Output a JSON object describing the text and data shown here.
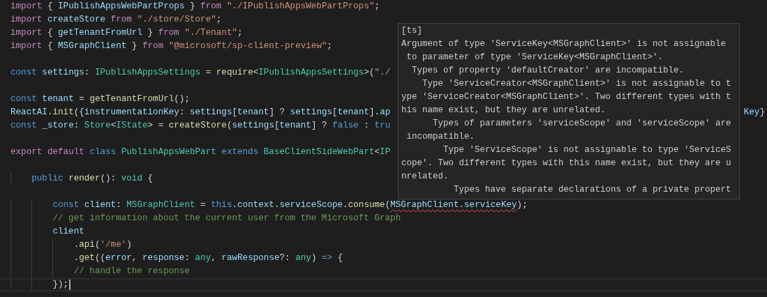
{
  "editor": {
    "lines": [
      {
        "current": false,
        "tokens": [
          {
            "text": "import ",
            "kind": "keyword"
          },
          {
            "text": "{ ",
            "kind": "plain"
          },
          {
            "text": "IPublishAppsWebPartProps ",
            "kind": "variable"
          },
          {
            "text": "} ",
            "kind": "plain"
          },
          {
            "text": "from ",
            "kind": "keyword"
          },
          {
            "text": "\"./IPublishAppsWebPartProps\"",
            "kind": "string"
          },
          {
            "text": ";",
            "kind": "plain"
          }
        ]
      },
      {
        "current": false,
        "tokens": [
          {
            "text": "import ",
            "kind": "keyword"
          },
          {
            "text": "createStore ",
            "kind": "variable"
          },
          {
            "text": "from ",
            "kind": "keyword"
          },
          {
            "text": "\"./store/Store\"",
            "kind": "string"
          },
          {
            "text": ";",
            "kind": "plain"
          }
        ]
      },
      {
        "current": false,
        "tokens": [
          {
            "text": "import ",
            "kind": "keyword"
          },
          {
            "text": "{ ",
            "kind": "plain"
          },
          {
            "text": "getTenantFromUrl ",
            "kind": "variable"
          },
          {
            "text": "} ",
            "kind": "plain"
          },
          {
            "text": "from ",
            "kind": "keyword"
          },
          {
            "text": "\"./Tenant\"",
            "kind": "string"
          },
          {
            "text": ";",
            "kind": "plain"
          }
        ]
      },
      {
        "current": false,
        "tokens": [
          {
            "text": "import ",
            "kind": "keyword"
          },
          {
            "text": "{ ",
            "kind": "plain"
          },
          {
            "text": "MSGraphClient ",
            "kind": "variable"
          },
          {
            "text": "} ",
            "kind": "plain"
          },
          {
            "text": "from ",
            "kind": "keyword"
          },
          {
            "text": "\"@microsoft/sp-client-preview\"",
            "kind": "string"
          },
          {
            "text": ";",
            "kind": "plain"
          }
        ]
      },
      {
        "current": false
      },
      {
        "current": false,
        "tokens": [
          {
            "text": "const ",
            "kind": "storage"
          },
          {
            "text": "settings",
            "kind": "variable"
          },
          {
            "text": ": ",
            "kind": "plain"
          },
          {
            "text": "IPublishAppsSettings ",
            "kind": "type"
          },
          {
            "text": "= ",
            "kind": "plain"
          },
          {
            "text": "require",
            "kind": "function"
          },
          {
            "text": "<",
            "kind": "plain"
          },
          {
            "text": "IPublishAppsSettings",
            "kind": "type"
          },
          {
            "text": ">(",
            "kind": "plain"
          },
          {
            "text": "\"./",
            "kind": "string"
          }
        ]
      },
      {
        "current": false
      },
      {
        "current": false,
        "tokens": [
          {
            "text": "const ",
            "kind": "storage"
          },
          {
            "text": "tenant ",
            "kind": "variable"
          },
          {
            "text": "= ",
            "kind": "plain"
          },
          {
            "text": "getTenantFromUrl",
            "kind": "function"
          },
          {
            "text": "();",
            "kind": "plain"
          }
        ]
      },
      {
        "current": false,
        "tokens": [
          {
            "text": "ReactAI",
            "kind": "variable"
          },
          {
            "text": ".",
            "kind": "plain"
          },
          {
            "text": "init",
            "kind": "function"
          },
          {
            "text": "({",
            "kind": "plain"
          },
          {
            "text": "instrumentationKey",
            "kind": "variable"
          },
          {
            "text": ": ",
            "kind": "plain"
          },
          {
            "text": "settings",
            "kind": "variable"
          },
          {
            "text": "[",
            "kind": "plain"
          },
          {
            "text": "tenant",
            "kind": "variable"
          },
          {
            "text": "] ? ",
            "kind": "plain"
          },
          {
            "text": "settings",
            "kind": "variable"
          },
          {
            "text": "[",
            "kind": "plain"
          },
          {
            "text": "tenant",
            "kind": "variable"
          },
          {
            "text": "].",
            "kind": "plain"
          },
          {
            "text": "ap",
            "kind": "variable"
          }
        ],
        "tail": [
          {
            "text": "Key",
            "kind": "variable"
          },
          {
            "text": "}",
            "kind": "plain"
          }
        ]
      },
      {
        "current": false,
        "tokens": [
          {
            "text": "const ",
            "kind": "storage"
          },
          {
            "text": "_store",
            "kind": "variable"
          },
          {
            "text": ": ",
            "kind": "plain"
          },
          {
            "text": "Store",
            "kind": "type"
          },
          {
            "text": "<",
            "kind": "plain"
          },
          {
            "text": "IState",
            "kind": "type"
          },
          {
            "text": "> = ",
            "kind": "plain"
          },
          {
            "text": "createStore",
            "kind": "function"
          },
          {
            "text": "(",
            "kind": "plain"
          },
          {
            "text": "settings",
            "kind": "variable"
          },
          {
            "text": "[",
            "kind": "plain"
          },
          {
            "text": "tenant",
            "kind": "variable"
          },
          {
            "text": "] ? ",
            "kind": "plain"
          },
          {
            "text": "false ",
            "kind": "storage"
          },
          {
            "text": ": ",
            "kind": "plain"
          },
          {
            "text": "tru",
            "kind": "storage"
          }
        ]
      },
      {
        "current": false
      },
      {
        "current": false,
        "tokens": [
          {
            "text": "export ",
            "kind": "keyword"
          },
          {
            "text": "default ",
            "kind": "keyword"
          },
          {
            "text": "class ",
            "kind": "storage"
          },
          {
            "text": "PublishAppsWebPart ",
            "kind": "type"
          },
          {
            "text": "extends ",
            "kind": "storage"
          },
          {
            "text": "BaseClientSideWebPart",
            "kind": "type"
          },
          {
            "text": "<",
            "kind": "plain"
          },
          {
            "text": "IP",
            "kind": "type"
          }
        ]
      },
      {
        "current": false
      },
      {
        "current": false,
        "tokens": [
          {
            "text": "    public ",
            "kind": "storage"
          },
          {
            "text": "render",
            "kind": "function"
          },
          {
            "text": "(): ",
            "kind": "plain"
          },
          {
            "text": "void ",
            "kind": "type"
          },
          {
            "text": "{",
            "kind": "plain"
          }
        ]
      },
      {
        "current": false
      },
      {
        "current": false,
        "tokens": [
          {
            "text": "        const ",
            "kind": "storage"
          },
          {
            "text": "client",
            "kind": "variable"
          },
          {
            "text": ": ",
            "kind": "plain"
          },
          {
            "text": "MSGraphClient ",
            "kind": "type"
          },
          {
            "text": "= ",
            "kind": "plain"
          },
          {
            "text": "this",
            "kind": "storage"
          },
          {
            "text": ".",
            "kind": "plain"
          },
          {
            "text": "context",
            "kind": "variable"
          },
          {
            "text": ".",
            "kind": "plain"
          },
          {
            "text": "serviceScope",
            "kind": "variable"
          },
          {
            "text": ".",
            "kind": "plain"
          },
          {
            "text": "consume",
            "kind": "function"
          },
          {
            "text": "(",
            "kind": "plain"
          },
          {
            "text": "MSGraphClient.serviceKey",
            "kind": "error"
          },
          {
            "text": ");",
            "kind": "plain"
          }
        ]
      },
      {
        "current": false,
        "tokens": [
          {
            "text": "        // get information about the current user from the Microsoft Graph",
            "kind": "comment"
          }
        ]
      },
      {
        "current": false,
        "tokens": [
          {
            "text": "        client",
            "kind": "variable"
          }
        ]
      },
      {
        "current": false,
        "tokens": [
          {
            "text": "            .",
            "kind": "plain"
          },
          {
            "text": "api",
            "kind": "function"
          },
          {
            "text": "(",
            "kind": "plain"
          },
          {
            "text": "'/me'",
            "kind": "string"
          },
          {
            "text": ")",
            "kind": "plain"
          }
        ]
      },
      {
        "current": false,
        "tokens": [
          {
            "text": "            .",
            "kind": "plain"
          },
          {
            "text": "get",
            "kind": "function"
          },
          {
            "text": "((",
            "kind": "plain"
          },
          {
            "text": "error",
            "kind": "variable"
          },
          {
            "text": ", ",
            "kind": "plain"
          },
          {
            "text": "response",
            "kind": "variable"
          },
          {
            "text": ": ",
            "kind": "plain"
          },
          {
            "text": "any",
            "kind": "type"
          },
          {
            "text": ", ",
            "kind": "plain"
          },
          {
            "text": "rawResponse",
            "kind": "variable"
          },
          {
            "text": "?: ",
            "kind": "plain"
          },
          {
            "text": "any",
            "kind": "type"
          },
          {
            "text": ") ",
            "kind": "plain"
          },
          {
            "text": "=> ",
            "kind": "storage"
          },
          {
            "text": "{",
            "kind": "plain"
          }
        ]
      },
      {
        "current": false,
        "tokens": [
          {
            "text": "            // handle the response",
            "kind": "comment"
          }
        ]
      },
      {
        "current": true,
        "tokens": [
          {
            "text": "        });",
            "kind": "plain"
          }
        ]
      }
    ]
  },
  "tooltip": {
    "lines": [
      "[ts]",
      "Argument of type 'ServiceKey<MSGraphClient>' is not assignable",
      " to parameter of type 'ServiceKey<MSGraphClient>'.",
      "  Types of property 'defaultCreator' are incompatible.",
      "    Type 'ServiceCreator<MSGraphClient>' is not assignable to t",
      "ype 'ServiceCreator<MSGraphClient>'. Two different types with t",
      "his name exist, but they are unrelated.",
      "      Types of parameters 'serviceScope' and 'serviceScope' are",
      " incompatible.",
      "        Type 'ServiceScope' is not assignable to type 'ServiceS",
      "cope'. Two different types with this name exist, but they are u",
      "nrelated.",
      "          Types have separate declarations of a private propert"
    ]
  }
}
